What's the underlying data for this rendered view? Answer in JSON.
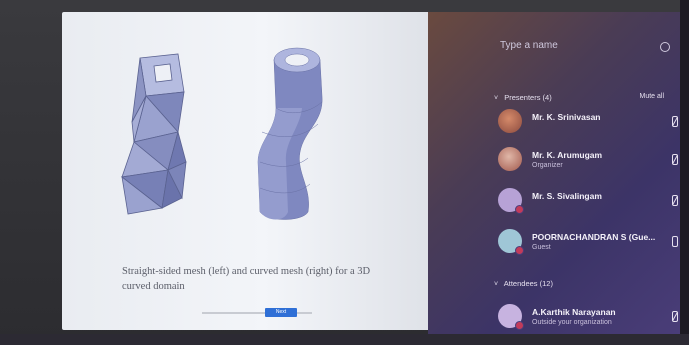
{
  "slide": {
    "caption": "Straight-sided mesh (left) and curved mesh (right) for a 3D curved domain",
    "nav_button": "Next"
  },
  "panel": {
    "search_placeholder": "Type a name",
    "presenters_heading": "Presenters (4)",
    "mute_all": "Mute all",
    "presenters": [
      {
        "name": "Mr. K. Srinivasan",
        "role": ""
      },
      {
        "name": "Mr. K. Arumugam",
        "role": "Organizer"
      },
      {
        "name": "Mr. S. Sivalingam",
        "role": ""
      },
      {
        "name": "POORNACHANDRAN S (Gue...",
        "role": "Guest"
      }
    ],
    "attendees_heading": "Attendees (12)",
    "attendees": [
      {
        "name": "A.Karthik Narayanan",
        "role": "Outside your organization"
      }
    ]
  },
  "colors": {
    "panel": "#4b3e7a",
    "accent": "#2f6fd6",
    "mesh": "#8a94c8"
  }
}
